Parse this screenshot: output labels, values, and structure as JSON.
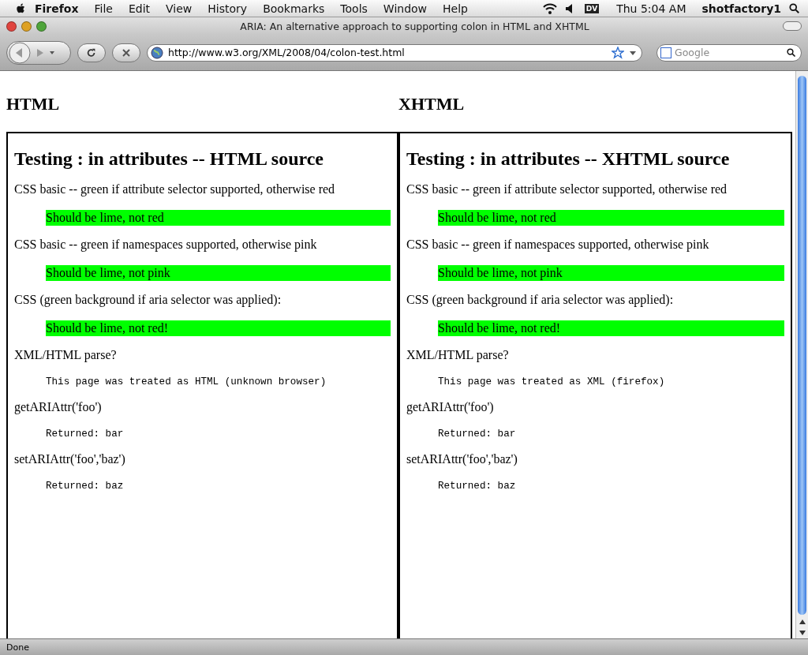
{
  "menubar": {
    "app": "Firefox",
    "items": [
      "File",
      "Edit",
      "View",
      "History",
      "Bookmarks",
      "Tools",
      "Window",
      "Help"
    ],
    "input_badge": "DV",
    "clock": "Thu 5:04 AM",
    "user": "shotfactory1"
  },
  "window": {
    "title": "ARIA: An alternative approach to supporting colon in HTML and XHTML"
  },
  "toolbar": {
    "url": "http://www.w3.org/XML/2008/04/colon-test.html",
    "search": {
      "placeholder": "Google"
    }
  },
  "page": {
    "columns": [
      {
        "heading": "HTML",
        "frame": {
          "title": "Testing : in attributes -- HTML source",
          "sections": [
            {
              "label": "CSS basic -- green if attribute selector supported, otherwise red",
              "kind": "highlight",
              "result": "Should be lime, not red"
            },
            {
              "label": "CSS basic -- green if namespaces supported, otherwise pink",
              "kind": "highlight",
              "result": "Should be lime, not pink"
            },
            {
              "label": "CSS (green background if aria selector was applied):",
              "kind": "highlight",
              "result": "Should be lime, not red!"
            },
            {
              "label": "XML/HTML parse?",
              "kind": "code",
              "result": "This page was treated as HTML (unknown browser)"
            },
            {
              "label": "getARIAttr('foo')",
              "kind": "code",
              "result": "Returned: bar"
            },
            {
              "label": "setARIAttr('foo','baz')",
              "kind": "code",
              "result": "Returned: baz"
            }
          ]
        }
      },
      {
        "heading": "XHTML",
        "frame": {
          "title": "Testing : in attributes -- XHTML source",
          "sections": [
            {
              "label": "CSS basic -- green if attribute selector supported, otherwise red",
              "kind": "highlight",
              "result": "Should be lime, not red"
            },
            {
              "label": "CSS basic -- green if namespaces supported, otherwise pink",
              "kind": "highlight",
              "result": "Should be lime, not pink"
            },
            {
              "label": "CSS (green background if aria selector was applied):",
              "kind": "highlight",
              "result": "Should be lime, not red!"
            },
            {
              "label": "XML/HTML parse?",
              "kind": "code",
              "result": "This page was treated as XML (firefox)"
            },
            {
              "label": "getARIAttr('foo')",
              "kind": "code",
              "result": "Returned: bar"
            },
            {
              "label": "setARIAttr('foo','baz')",
              "kind": "code",
              "result": "Returned: baz"
            }
          ]
        }
      }
    ]
  },
  "status_bar": {
    "text": "Done"
  }
}
